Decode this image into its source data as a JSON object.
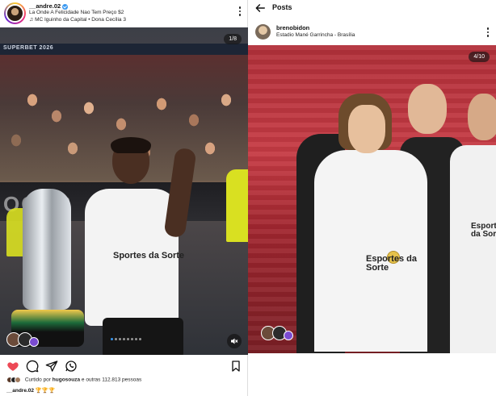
{
  "left_post": {
    "username": "__andre.02",
    "song_line": "La Onde A Felicidade Nao Tem Preço $2",
    "music_line": "MC Iguinho da Capital",
    "music_separator": "•",
    "music_extra": "Dona Cecília 3",
    "banner_text": "SUPERBET 2026",
    "ad_board_text": "OCOB",
    "shirt_text": "Sportes da Sorte",
    "media_counter": "1/8",
    "carousel_active_index": 0,
    "carousel_dot_count": 8,
    "liked_prefix": "Curtido por",
    "liked_user": "hugosouza",
    "liked_suffix": "e outras 112.813 pessoas",
    "caption_user": "__andre.02",
    "caption_text": "🏆🏆🏆",
    "icons": {
      "like": "heart-filled-icon",
      "comment": "comment-icon",
      "share": "share-icon",
      "whatsapp": "whatsapp-icon",
      "save": "bookmark-icon",
      "mute": "speaker-muted-icon",
      "more": "more-options-icon",
      "music": "music-note-icon"
    },
    "colors": {
      "like": "#ed4956",
      "verified": "#3797f0"
    }
  },
  "right_post": {
    "header_title": "Posts",
    "username": "brenobidon",
    "location": "Estadio Mané Garrincha - Brasília",
    "media_counter": "4/10",
    "shirt_text_center": "Esportes da Sorte",
    "shirt_text_right": "Esportes da Sorte",
    "icons": {
      "back": "back-arrow-icon",
      "more": "more-options-icon"
    }
  }
}
